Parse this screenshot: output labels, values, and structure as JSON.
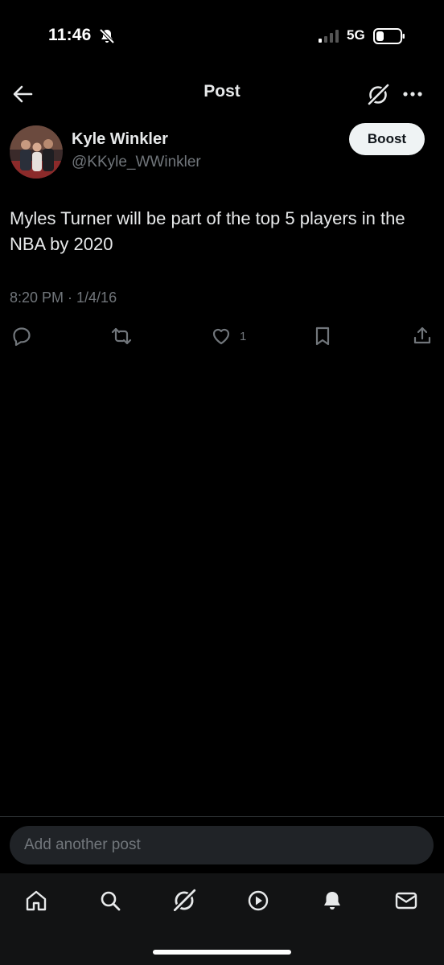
{
  "status_bar": {
    "time": "11:46",
    "network": "5G"
  },
  "header": {
    "title": "Post"
  },
  "post": {
    "author_name": "Kyle Winkler",
    "author_handle": "@KKyle_WWinkler",
    "boost_label": "Boost",
    "text": "Myles Turner will be part of the top 5 players in the NBA by 2020",
    "timestamp": "8:20 PM · 1/4/16",
    "like_count": "1"
  },
  "reply": {
    "placeholder": "Add another post"
  },
  "icons": [
    "back-arrow-icon",
    "grok-icon",
    "more-icon",
    "reply-icon",
    "repost-icon",
    "heart-icon",
    "bookmark-icon",
    "share-icon",
    "home-icon",
    "search-icon",
    "video-icon",
    "bell-icon",
    "mail-icon"
  ],
  "colors": {
    "background": "#000000",
    "text": "#e7e9ea",
    "secondary_text": "#71767b",
    "boost_bg": "#eff3f4",
    "input_bg": "#202327"
  }
}
